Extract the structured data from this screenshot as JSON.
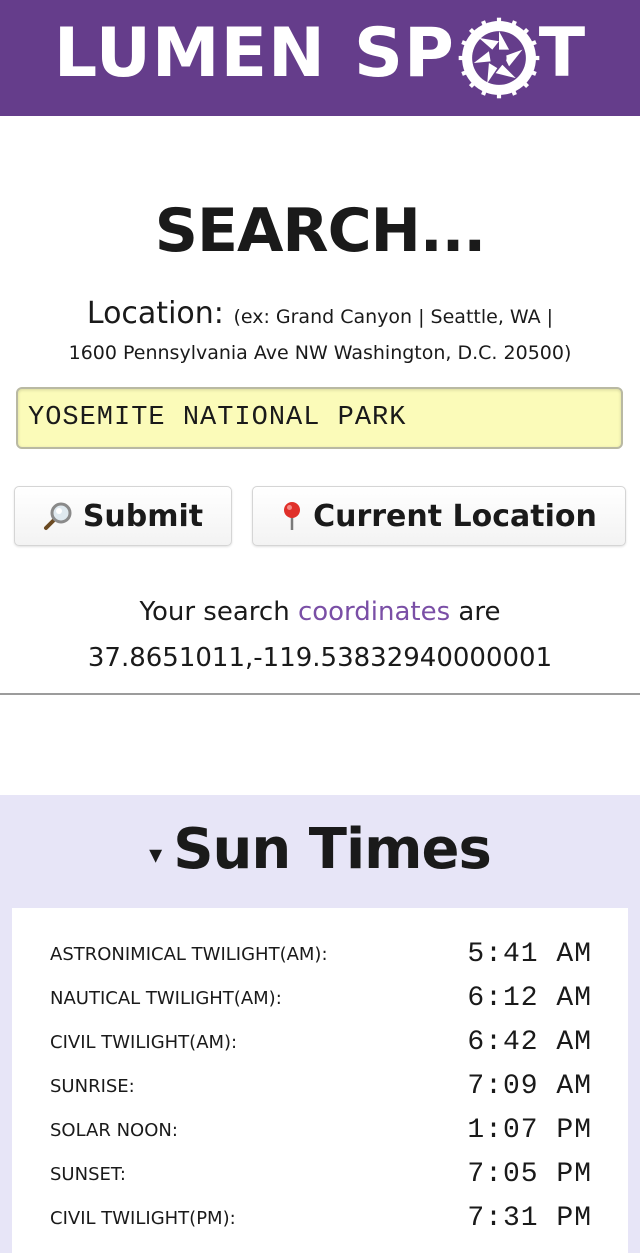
{
  "header": {
    "logo_part1": "LUMEN",
    "logo_part2": "SP",
    "logo_part3": "T",
    "bg_color": "#653d8b"
  },
  "search": {
    "title": "SEARCH...",
    "location_label": "Location:",
    "location_example_1": "(ex: Grand Canyon | Seattle, WA |",
    "location_example_2": "1600 Pennsylvania Ave NW Washington, D.C. 20500)",
    "input_value": "YOSEMITE NATIONAL PARK",
    "submit_label": "Submit",
    "submit_icon": "magnifier-icon",
    "current_location_label": "Current Location",
    "current_location_icon": "pin-icon"
  },
  "coordinates": {
    "prefix": "Your search",
    "link_text": "coordinates",
    "suffix": "are",
    "value": "37.8651011,-119.53832940000001"
  },
  "sun_times": {
    "toggle": "▾",
    "title": "Sun Times",
    "rows": [
      {
        "label": "ASTRONIMICAL TWILIGHT(AM):",
        "time": "5:41 AM"
      },
      {
        "label": "NAUTICAL TWILIGHT(AM):",
        "time": "6:12 AM"
      },
      {
        "label": "CIVIL TWILIGHT(AM):",
        "time": "6:42 AM"
      },
      {
        "label": "SUNRISE:",
        "time": "7:09 AM"
      },
      {
        "label": "SOLAR NOON:",
        "time": "1:07 PM"
      },
      {
        "label": "SUNSET:",
        "time": "7:05 PM"
      },
      {
        "label": "CIVIL TWILIGHT(PM):",
        "time": "7:31 PM"
      }
    ]
  },
  "colors": {
    "accent": "#653d8b",
    "link": "#7a4fa6",
    "input_bg": "#fbfbb9",
    "section_bg": "#e7e5f7"
  }
}
